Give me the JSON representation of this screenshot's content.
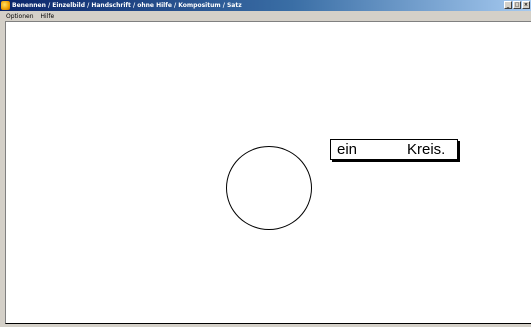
{
  "window": {
    "title": "Benennen / Einzelbild / Handschrift / ohne Hilfe / Kompositum / Satz",
    "buttons": {
      "minimize_glyph": "_",
      "maximize_glyph": "□",
      "close_glyph": "×"
    }
  },
  "menu": {
    "items": [
      {
        "label": "Optionen"
      },
      {
        "label": "Hilfe"
      }
    ]
  },
  "exercise": {
    "picture": "circle",
    "sentence": {
      "words": [
        "ein",
        "Kreis."
      ]
    }
  },
  "colors": {
    "titlebar_start": "#0a246a",
    "titlebar_end": "#a6caf0",
    "canvas": "#ffffff",
    "drawing": "#000000"
  }
}
